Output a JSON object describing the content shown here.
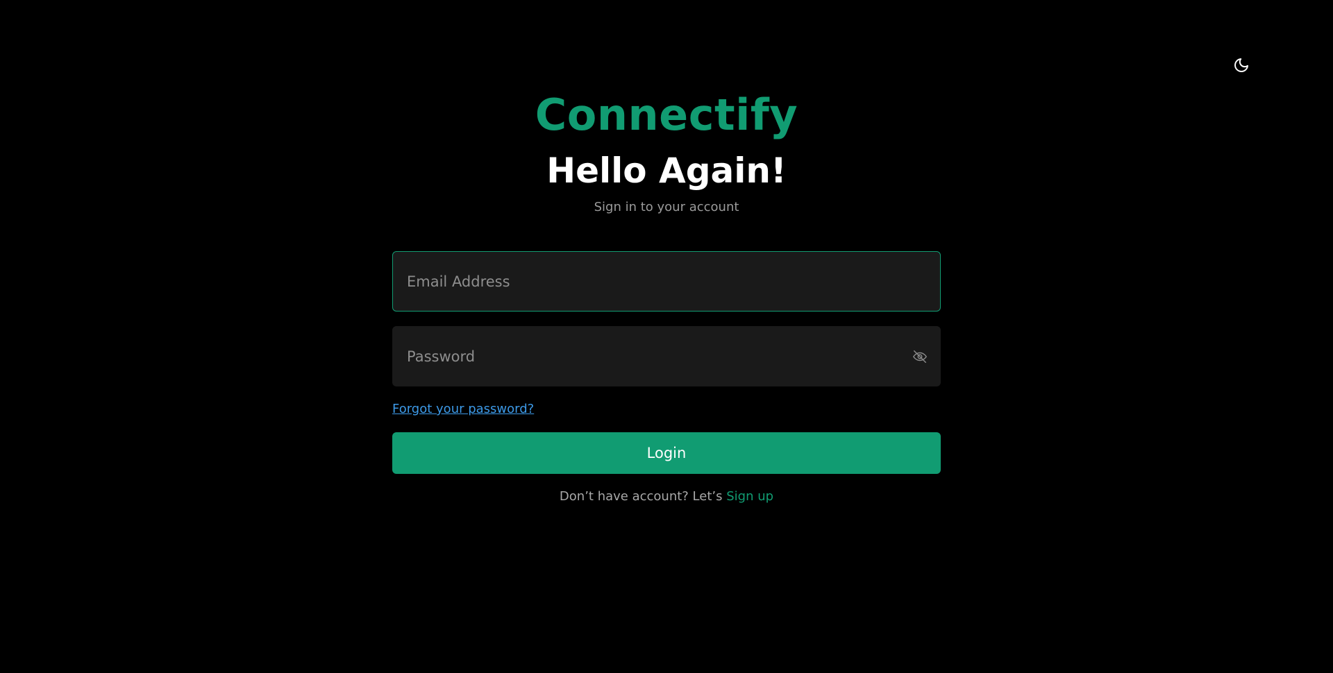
{
  "theme_toggle": {
    "icon": "moon-icon"
  },
  "brand": {
    "name": "Connectify",
    "color": "#119c72"
  },
  "header": {
    "title": "Hello Again!",
    "subtitle": "Sign in to your account"
  },
  "form": {
    "email": {
      "placeholder": "Email Address",
      "value": ""
    },
    "password": {
      "placeholder": "Password",
      "value": "",
      "toggle_icon": "eye-off-icon"
    },
    "forgot_label": "Forgot your password?",
    "login_label": "Login"
  },
  "footer": {
    "prompt": "Don’t have account? Let’s",
    "signup_label": "Sign up"
  },
  "colors": {
    "background": "#000000",
    "accent": "#119c72",
    "link": "#3d9ae8",
    "input_bg": "#1a1a1a"
  }
}
